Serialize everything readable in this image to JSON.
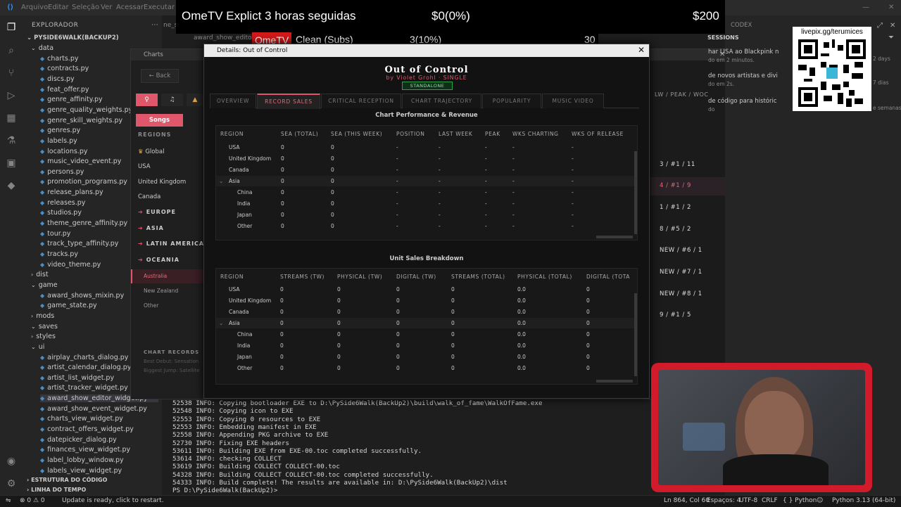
{
  "topbar": {
    "menus": [
      "Arquivo",
      "Editar",
      "Seleção",
      "Ver",
      "Acessar",
      "Executar"
    ]
  },
  "stream": {
    "line1_left": "OmeTV Explict 3 horas seguidas",
    "line1_mid": "$0(0%)",
    "line1_right": "$200",
    "tag": "OmeTV",
    "line2_left": "Clean (Subs)",
    "line2_mid": "3(10%)",
    "line2_right": "30"
  },
  "explorer": {
    "header": "EXPLORADOR",
    "root": "PYSIDE6WALK(BACKUP2)",
    "items": [
      {
        "label": "data",
        "type": "folder-open"
      },
      {
        "label": "charts.py"
      },
      {
        "label": "contracts.py"
      },
      {
        "label": "discs.py"
      },
      {
        "label": "feat_offer.py"
      },
      {
        "label": "genre_affinity.py"
      },
      {
        "label": "genre_quality_weights.py"
      },
      {
        "label": "genre_skill_weights.py"
      },
      {
        "label": "genres.py"
      },
      {
        "label": "labels.py"
      },
      {
        "label": "locations.py"
      },
      {
        "label": "music_video_event.py"
      },
      {
        "label": "persons.py"
      },
      {
        "label": "promotion_programs.py"
      },
      {
        "label": "release_plans.py"
      },
      {
        "label": "releases.py"
      },
      {
        "label": "studios.py"
      },
      {
        "label": "theme_genre_affinity.py"
      },
      {
        "label": "tour.py"
      },
      {
        "label": "track_type_affinity.py"
      },
      {
        "label": "tracks.py"
      },
      {
        "label": "video_theme.py"
      },
      {
        "label": "dist",
        "type": "folder"
      },
      {
        "label": "game",
        "type": "folder-open"
      },
      {
        "label": "award_shows_mixin.py"
      },
      {
        "label": "game_state.py"
      },
      {
        "label": "mods",
        "type": "folder"
      },
      {
        "label": "saves",
        "type": "folder-open"
      },
      {
        "label": "styles",
        "type": "folder"
      },
      {
        "label": "ui",
        "type": "folder-open"
      },
      {
        "label": "airplay_charts_dialog.py"
      },
      {
        "label": "artist_calendar_dialog.py"
      },
      {
        "label": "artist_list_widget.py"
      },
      {
        "label": "artist_tracker_widget.py"
      },
      {
        "label": "award_show_editor_widget.py",
        "selected": true
      },
      {
        "label": "award_show_event_widget.py"
      },
      {
        "label": "charts_view_widget.py"
      },
      {
        "label": "contract_offers_widget.py"
      },
      {
        "label": "datepicker_dialog.py"
      },
      {
        "label": "finances_view_widget.py"
      },
      {
        "label": "label_lobby_window.py"
      },
      {
        "label": "labels_view_widget.py"
      }
    ],
    "footer1": "ESTRUTURA DO CÓDIGO",
    "footer2": "LINHA DO TEMPO"
  },
  "editor_tabs": {
    "tab1": "ne_st",
    "tab2": "award_show_editor_w"
  },
  "charts_window": {
    "title": "Charts",
    "back": "← Back",
    "songs": "Songs",
    "regions_header": "REGIONS",
    "global": "Global",
    "regions": [
      "USA",
      "United Kingdom",
      "Canada"
    ],
    "groups": [
      "EUROPE",
      "ASIA",
      "LATIN AMERICA",
      "OCEANIA"
    ],
    "oceania_items": [
      "Australia",
      "New Zealand",
      "Other"
    ],
    "col_header": "LW / PEAK / WOC",
    "ranks": [
      "3 / #1 / 11",
      "4 / #1 / 9",
      "1 / #1 / 2",
      "8 / #5 / 2",
      "NEW / #6 / 1",
      "NEW / #7 / 1",
      "NEW / #8 / 1",
      "9 / #1 / 5"
    ],
    "records_header": "CHART RECORDS",
    "records_line1": "Best Debut: Sensation",
    "records_line2": "Biggest Jump: Satellite"
  },
  "codex": {
    "header": "CODEX",
    "sessions": "SESSIONS",
    "items": [
      {
        "text": "har LISA ao Blackpink n",
        "sub": "do em 2 minutos.",
        "time": "2 days"
      },
      {
        "text": "de novos artistas e divi",
        "sub": "do em 2s.",
        "time": "7 dias"
      },
      {
        "text": "de código para históric",
        "sub": "do",
        "time": "e semanas"
      }
    ]
  },
  "qr": {
    "label": "livepix.gg/terumices"
  },
  "dialog": {
    "title": "Details: Out of Control",
    "song": "Out of Control",
    "byline": "by Violet Grohl · SINGLE",
    "badge": "STANDALONE",
    "tabs": [
      "OVERVIEW",
      "RECORD SALES",
      "CRITICAL RECEPTION",
      "CHART TRAJECTORY",
      "POPULARITY",
      "MUSIC VIDEO"
    ],
    "active_tab": "RECORD SALES",
    "perf_title": "Chart Performance & Revenue",
    "perf_columns": [
      "REGION",
      "SEA (TOTAL)",
      "SEA (THIS WEEK)",
      "POSITION",
      "LAST WEEK",
      "PEAK",
      "WKS CHARTING",
      "WKS OF RELEASE"
    ],
    "perf_rows": [
      [
        "USA",
        "0",
        "0",
        "-",
        "-",
        "-",
        "-",
        "-"
      ],
      [
        "United Kingdom",
        "0",
        "0",
        "-",
        "-",
        "-",
        "-",
        "-"
      ],
      [
        "Canada",
        "0",
        "0",
        "-",
        "-",
        "-",
        "-",
        "-"
      ],
      [
        "Asia",
        "0",
        "0",
        "-",
        "-",
        "-",
        "-",
        "-"
      ],
      [
        "China",
        "0",
        "0",
        "-",
        "-",
        "-",
        "-",
        "-"
      ],
      [
        "India",
        "0",
        "0",
        "-",
        "-",
        "-",
        "-",
        "-"
      ],
      [
        "Japan",
        "0",
        "0",
        "-",
        "-",
        "-",
        "-",
        "-"
      ],
      [
        "Other",
        "0",
        "0",
        "-",
        "-",
        "-",
        "-",
        "-"
      ]
    ],
    "units_title": "Unit Sales Breakdown",
    "units_columns": [
      "REGION",
      "STREAMS (TW)",
      "PHYSICAL (TW)",
      "DIGITAL (TW)",
      "STREAMS (TOTAL)",
      "PHYSICAL (TOTAL)",
      "DIGITAL (TOTA"
    ],
    "units_rows": [
      [
        "USA",
        "0",
        "0",
        "0",
        "0",
        "0.0",
        "0"
      ],
      [
        "United Kingdom",
        "0",
        "0",
        "0",
        "0",
        "0.0",
        "0"
      ],
      [
        "Canada",
        "0",
        "0",
        "0",
        "0",
        "0.0",
        "0"
      ],
      [
        "Asia",
        "0",
        "0",
        "0",
        "0",
        "0.0",
        "0"
      ],
      [
        "China",
        "0",
        "0",
        "0",
        "0",
        "0.0",
        "0"
      ],
      [
        "India",
        "0",
        "0",
        "0",
        "0",
        "0.0",
        "0"
      ],
      [
        "Japan",
        "0",
        "0",
        "0",
        "0",
        "0.0",
        "0"
      ],
      [
        "Other",
        "0",
        "0",
        "0",
        "0",
        "0.0",
        "0"
      ]
    ]
  },
  "terminal": {
    "lines": [
      "52538 INFO: Copying bootloader EXE to D:\\PySide6Walk(BackUp2)\\build\\walk_of_fame\\WalkOfFame.exe",
      "52548 INFO: Copying icon to EXE",
      "52553 INFO: Copying 0 resources to EXE",
      "52553 INFO: Embedding manifest in EXE",
      "52558 INFO: Appending PKG archive to EXE",
      "52730 INFO: Fixing EXE headers",
      "53611 INFO: Building EXE from EXE-00.toc completed successfully.",
      "53614 INFO: checking COLLECT",
      "53619 INFO: Building COLLECT COLLECT-00.toc",
      "54328 INFO: Building COLLECT COLLECT-00.toc completed successfully.",
      "54333 INFO: Build complete! The results are available in: D:\\PySide6Walk(BackUp2)\\dist",
      "PS D:\\PySide6Walk(BackUp2)> "
    ]
  },
  "statusbar": {
    "errors": "⊗ 0 ⚠ 0",
    "update": "Update is ready, click to restart.",
    "position": "Ln 864, Col 60",
    "spaces": "Espaços: 4",
    "encoding": "UTF-8",
    "eol": "CRLF",
    "lang": "{ } Python",
    "interpreter": "Python 3.13 (64-bit)"
  }
}
